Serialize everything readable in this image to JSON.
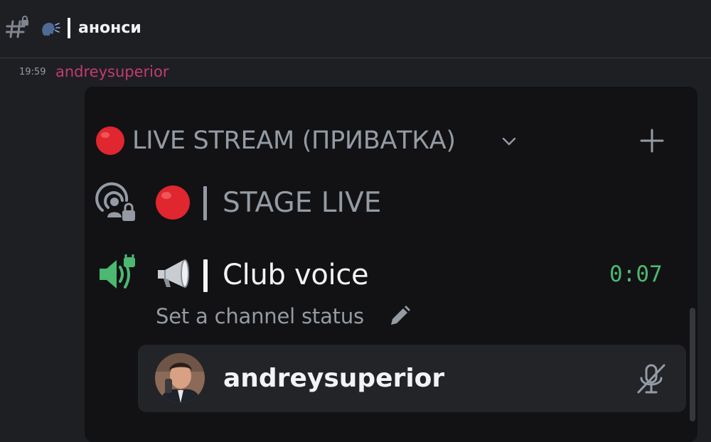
{
  "header": {
    "channel_icon": "hash-lock-icon",
    "emoji": "speaking-head-icon",
    "title": "анонси"
  },
  "message": {
    "timestamp": "19:59",
    "author": "andreysuperior",
    "author_color": "#c23b74"
  },
  "attachment": {
    "category": {
      "label": "LIVE STREAM (ПРИВАТКА)",
      "emoji": "red-circle-icon",
      "chevron": "chevron-down-icon",
      "add": "plus-icon"
    },
    "channels": [
      {
        "type": "stage",
        "icon": "stage-lock-icon",
        "emoji": "red-circle-icon",
        "label": "STAGE LIVE"
      },
      {
        "type": "voice",
        "icon": "speaker-lock-icon",
        "emoji": "megaphone-icon",
        "label": "Club voice",
        "timer": "0:07",
        "status_placeholder": "Set a channel status",
        "status_icon": "pencil-icon"
      }
    ],
    "voice_user": {
      "name": "andreysuperior",
      "avatar": "avatar",
      "mute_icon": "mic-muted-icon"
    }
  },
  "colors": {
    "background": "#1e1f22",
    "card": "#121214",
    "muted_text": "#949ba4",
    "primary_text": "#f2f3f5",
    "voice_green": "#4cb870",
    "live_red": "#e0262f"
  }
}
